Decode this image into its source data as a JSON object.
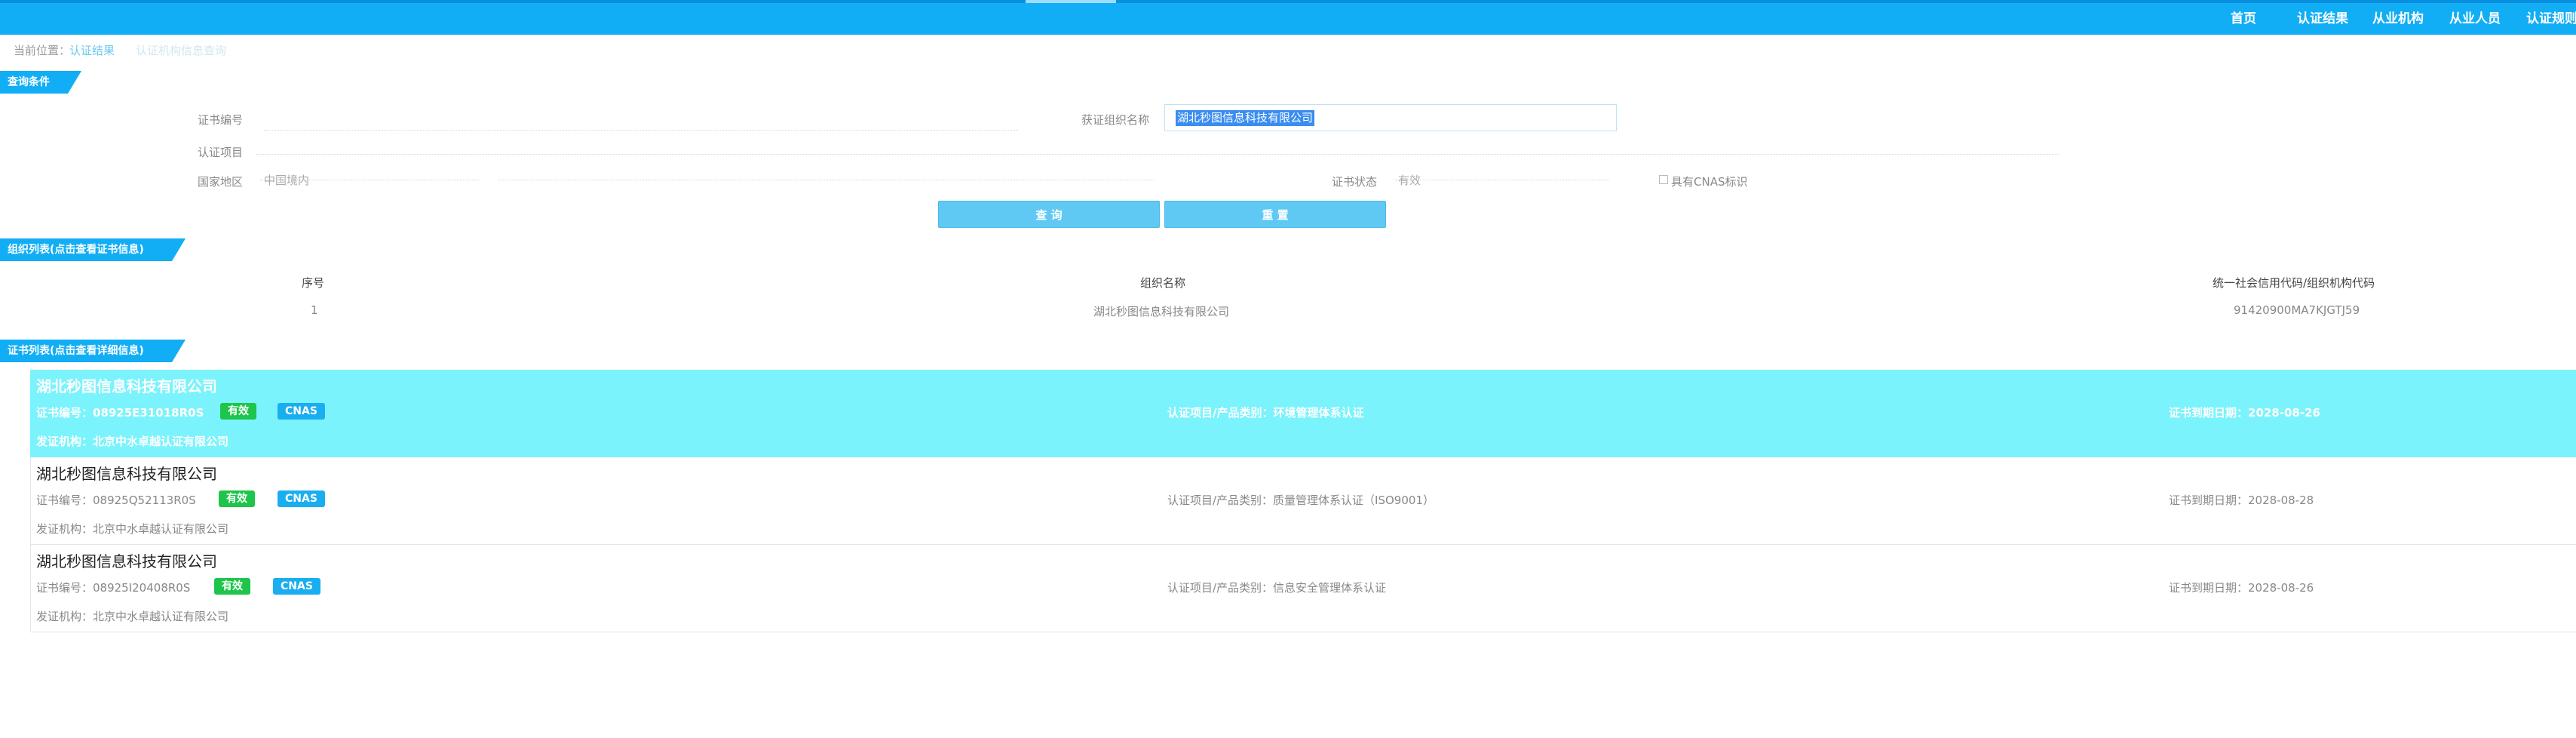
{
  "nav": {
    "items": [
      "首页",
      "认证结果",
      "从业机构",
      "从业人员",
      "认证规则"
    ]
  },
  "breadcrumb": {
    "prefix": "当前位置：",
    "link": "认证结果",
    "current": "认证机构信息查询"
  },
  "query": {
    "section_title": "查询条件",
    "cert_no_label": "证书编号",
    "org_name_label": "获证组织名称",
    "org_name_value": "湖北秒图信息科技有限公司",
    "project_label": "认证项目",
    "region_label": "国家地区",
    "region_value": "中国境内",
    "status_label": "证书状态",
    "status_value": "有效",
    "cnas_label": "具有CNAS标识",
    "search_button": "查 询",
    "reset_button": "重 置"
  },
  "org_list": {
    "section_title": "组织列表(点击查看证书信息)",
    "headers": [
      "序号",
      "组织名称",
      "统一社会信用代码/组织机构代码"
    ],
    "rows": [
      {
        "no": "1",
        "name": "湖北秒图信息科技有限公司",
        "code": "91420900MA7KJGTJ59"
      }
    ]
  },
  "cert_list": {
    "section_title": "证书列表(点击查看详细信息)",
    "items": [
      {
        "org": "湖北秒图信息科技有限公司",
        "cert_no": "证书编号：08925E31018R0S",
        "status_badge": "有效",
        "cnas_badge": "CNAS",
        "project": "认证项目/产品类别：环境管理体系认证",
        "expiry": "证书到期日期：2028-08-26",
        "issuer": "发证机构：北京中水卓越认证有限公司"
      },
      {
        "org": "湖北秒图信息科技有限公司",
        "cert_no": "证书编号：08925Q52113R0S",
        "status_badge": "有效",
        "cnas_badge": "CNAS",
        "project": "认证项目/产品类别：质量管理体系认证（ISO9001）",
        "expiry": "证书到期日期：2028-08-28",
        "issuer": "发证机构：北京中水卓越认证有限公司"
      },
      {
        "org": "湖北秒图信息科技有限公司",
        "cert_no": "证书编号：08925I20408R0S",
        "status_badge": "有效",
        "cnas_badge": "CNAS",
        "project": "认证项目/产品类别：信息安全管理体系认证",
        "expiry": "证书到期日期：2028-08-26",
        "issuer": "发证机构：北京中水卓越认证有限公司"
      }
    ]
  },
  "colors": {
    "nav_bg": "#12aef5",
    "highlight_row": "#7bf3fc",
    "badge_valid": "#1ec54a",
    "badge_cnas": "#19aef0",
    "button_bg": "#5fc9f4",
    "selection": "#3a8df0"
  }
}
